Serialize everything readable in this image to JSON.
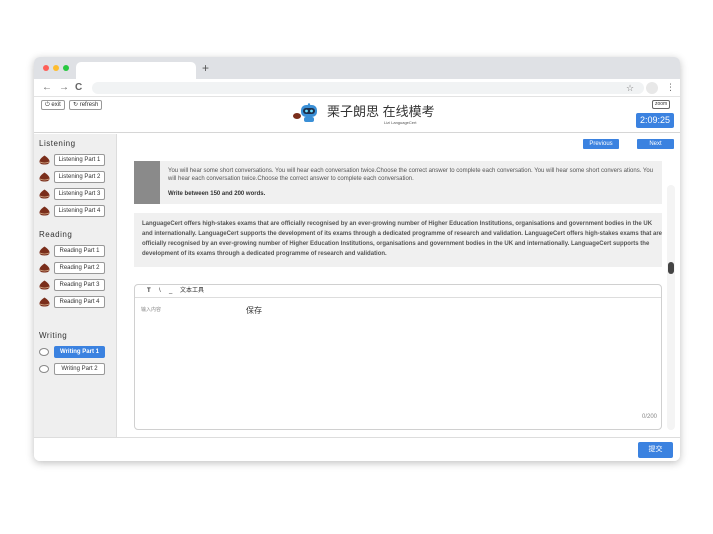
{
  "browser": {
    "new_tab": "+",
    "back": "←",
    "forward": "→",
    "reload": "C",
    "star": "☆",
    "menu": "⋮"
  },
  "header": {
    "exit_label": "exit",
    "refresh_label": "refresh",
    "brand_title": "栗子朗思 在线模考",
    "brand_subtitle": "Lizi LanguageCert",
    "zoom_label": "zoom",
    "timer": "2:09:25"
  },
  "sidebar": {
    "sections": [
      {
        "title": "Listening",
        "items": [
          "Listening Part 1",
          "Listening Part 2",
          "Listening Part 3",
          "Listening Part 4"
        ]
      },
      {
        "title": "Reading",
        "items": [
          "Reading Part 1",
          "Reading Part 2",
          "Reading Part 3",
          "Reading Part 4"
        ]
      },
      {
        "title": "Writing",
        "items": [
          "Writing Part 1",
          "Writing Part 2"
        ],
        "active": "Writing Part 1"
      }
    ]
  },
  "main": {
    "previous_label": "Previous",
    "next_label": "Next",
    "instruction": "You will hear some short conversations. You will hear each conversation twice.Choose the correct answer to complete each conversation. You will hear some short convers ations. You will hear each conversation twice.Choose the correct answer to complete each conversation.",
    "word_limit": "Write between 150 and 200 words.",
    "passage": "LanguageCert offers high-stakes exams that are officially recognised by an ever-growing number of Higher Education Institutions, organisations and government bodies in the UK and internationally. LanguageCert supports the development of its exams through a dedicated programme of research and validation. LanguageCert offers high-stakes exams that are officially recognised by an ever-growing number of Higher Education Institutions, organisations and government bodies in the UK and internationally. LanguageCert supports the development of its exams through a dedicated programme of research and validation.",
    "editor": {
      "tool_bold": "T",
      "tool_italic": "\\",
      "tool_underline": "_",
      "tool_text": "文本工具",
      "placeholder": "输入内容",
      "save_label": "保存",
      "counter": "0/200"
    },
    "submit_label": "提交"
  },
  "colors": {
    "accent": "#3b82e0",
    "sidebar_bg": "#efefef",
    "panel_bg": "#f0f0f0"
  }
}
